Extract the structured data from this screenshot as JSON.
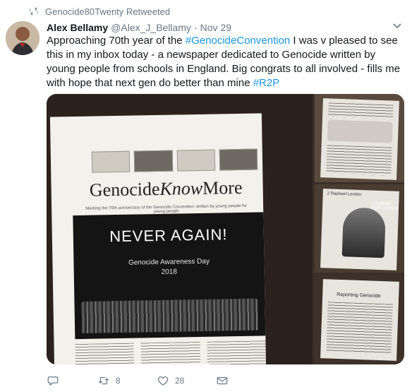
{
  "retweet_context": {
    "label": "Genocide80Twenty Retweeted",
    "icon": "retweet-icon"
  },
  "tweet": {
    "author_name": "Alex Bellamy",
    "author_handle": "@Alex_J_Bellamy",
    "separator": "·",
    "date": "Nov 29",
    "text_parts": {
      "p1": "Approaching 70th year of the ",
      "hashtag1": "#GenocideConvention",
      "p2": " I was v pleased to see this in my inbox today - a newspaper dedicated to Genocide written by young people from schools in England. Big congrats to all involved - fills me with hope that next gen do better than mine ",
      "hashtag2": "#R2P"
    }
  },
  "media": {
    "main_photo": {
      "masthead_part1": "Genocide",
      "masthead_part2": "Know",
      "masthead_part3": "More",
      "subtitle": "Marking the 70th anniversary of the Genocide Convention: written by young people for young people",
      "poster_title": "NEVER AGAIN!",
      "poster_line1": "Genocide Awareness Day",
      "poster_line2": "2018"
    },
    "side_photo_2": {
      "header": "2 Raphael Lemkin",
      "label": "LOOKING FOR LEMKIN"
    },
    "side_photo_3": {
      "title": "Reporting Genocide"
    }
  },
  "actions": {
    "reply_count": "",
    "retweet_count": "8",
    "like_count": "28"
  },
  "colors": {
    "link": "#1b95e0",
    "meta": "#657786",
    "text": "#14171a"
  }
}
